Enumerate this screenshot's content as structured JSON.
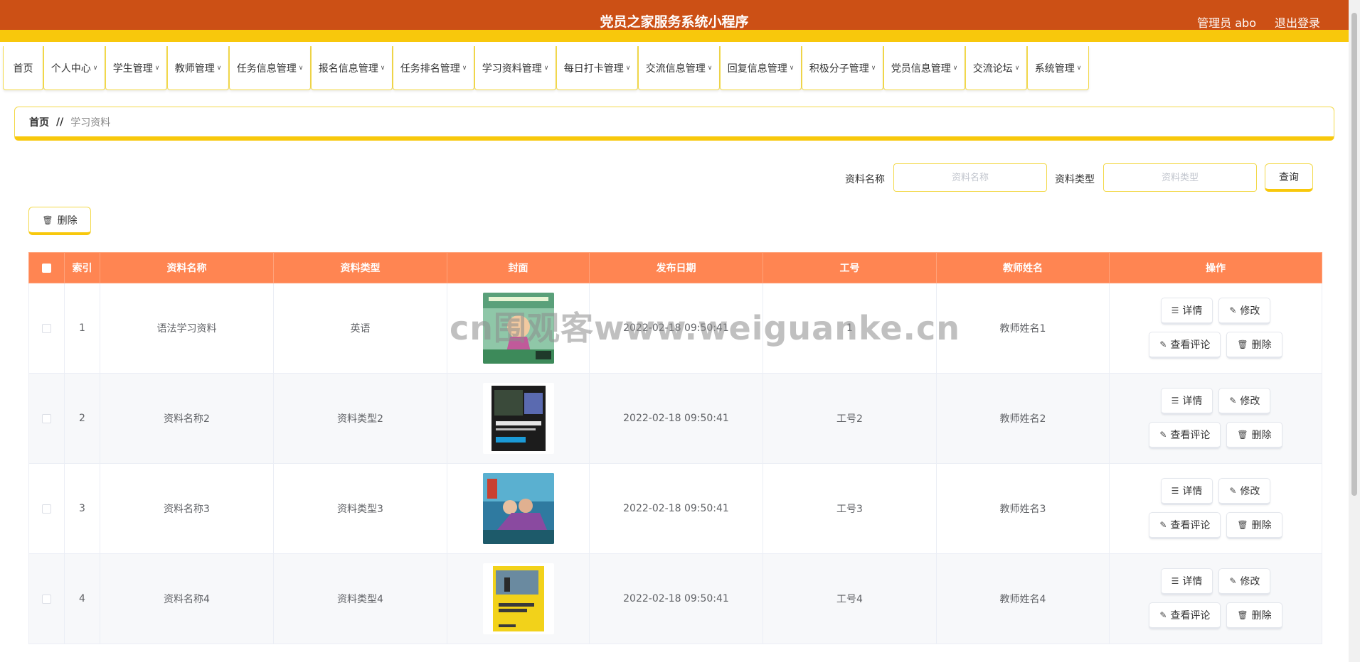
{
  "header": {
    "title": "党员之家服务系统小程序",
    "user_label": "管理员 abo",
    "logout_label": "退出登录"
  },
  "nav": {
    "items": [
      {
        "label": "首页",
        "has_dropdown": false
      },
      {
        "label": "个人中心",
        "has_dropdown": true
      },
      {
        "label": "学生管理",
        "has_dropdown": true
      },
      {
        "label": "教师管理",
        "has_dropdown": true
      },
      {
        "label": "任务信息管理",
        "has_dropdown": true
      },
      {
        "label": "报名信息管理",
        "has_dropdown": true
      },
      {
        "label": "任务排名管理",
        "has_dropdown": true
      },
      {
        "label": "学习资料管理",
        "has_dropdown": true
      },
      {
        "label": "每日打卡管理",
        "has_dropdown": true
      },
      {
        "label": "交流信息管理",
        "has_dropdown": true
      },
      {
        "label": "回复信息管理",
        "has_dropdown": true
      },
      {
        "label": "积极分子管理",
        "has_dropdown": true
      },
      {
        "label": "党员信息管理",
        "has_dropdown": true
      },
      {
        "label": "交流论坛",
        "has_dropdown": true
      },
      {
        "label": "系统管理",
        "has_dropdown": true
      }
    ]
  },
  "breadcrumb": {
    "home": "首页",
    "separator": "//",
    "current": "学习资料"
  },
  "search": {
    "name_label": "资料名称",
    "name_placeholder": "资料名称",
    "type_label": "资料类型",
    "type_placeholder": "资料类型",
    "query_label": "查询"
  },
  "toolbar": {
    "delete_label": "删除"
  },
  "table": {
    "headers": [
      "索引",
      "资料名称",
      "资料类型",
      "封面",
      "发布日期",
      "工号",
      "教师姓名",
      "操作"
    ],
    "actions": {
      "detail": "详情",
      "edit": "修改",
      "comments": "查看评论",
      "delete": "删除"
    },
    "rows": [
      {
        "index": "1",
        "name": "语法学习资料",
        "type": "英语",
        "date": "2022-02-18 09:50:41",
        "job_no": "1",
        "teacher": "教师姓名1"
      },
      {
        "index": "2",
        "name": "资料名称2",
        "type": "资料类型2",
        "date": "2022-02-18 09:50:41",
        "job_no": "工号2",
        "teacher": "教师姓名2"
      },
      {
        "index": "3",
        "name": "资料名称3",
        "type": "资料类型3",
        "date": "2022-02-18 09:50:41",
        "job_no": "工号3",
        "teacher": "教师姓名3"
      },
      {
        "index": "4",
        "name": "资料名称4",
        "type": "资料类型4",
        "date": "2022-02-18 09:50:41",
        "job_no": "工号4",
        "teacher": "教师姓名4"
      }
    ]
  },
  "watermark": "cn围观客www.weiguanke.cn",
  "colors": {
    "header_bg": "#cc5015",
    "accent_yellow": "#f8c80c",
    "table_header": "#ff8552"
  }
}
